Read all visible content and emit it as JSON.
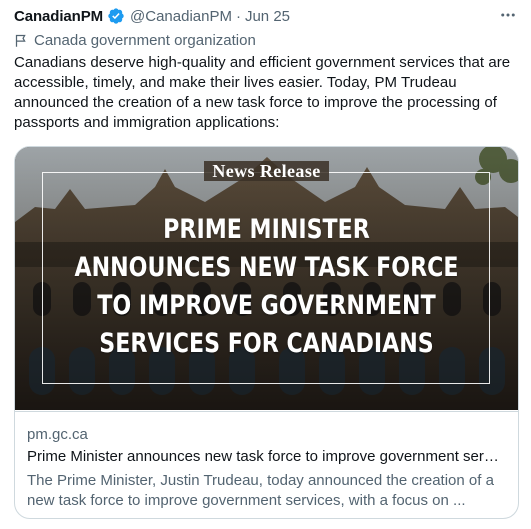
{
  "tweet": {
    "author_name": "CanadianPM",
    "handle": "@CanadianPM",
    "separator": "·",
    "date": "Jun 25",
    "affiliation": "Canada government organization",
    "text": "Canadians deserve high-quality and efficient government services that are accessible, timely, and make their lives easier. Today, PM Trudeau announced the creation of a new task force to improve the processing of passports and immigration applications:",
    "icons": {
      "verified": "verified-badge-icon",
      "affiliation": "flag-icon",
      "more": "more-options-icon"
    }
  },
  "card": {
    "image": {
      "kicker": "News Release",
      "headline_lines": [
        "PRIME MINISTER",
        "ANNOUNCES NEW TASK FORCE",
        "TO IMPROVE GOVERNMENT",
        "SERVICES FOR CANADIANS"
      ]
    },
    "domain": "pm.gc.ca",
    "title": "Prime Minister announces new task force to improve government servi...",
    "description": "The Prime Minister, Justin Trudeau, today announced the creation of a new task force to improve government services, with a focus on ..."
  },
  "colors": {
    "text_primary": "#0f1419",
    "text_secondary": "#536471",
    "verified_blue": "#1d9bf0",
    "border": "#cfd9de"
  }
}
